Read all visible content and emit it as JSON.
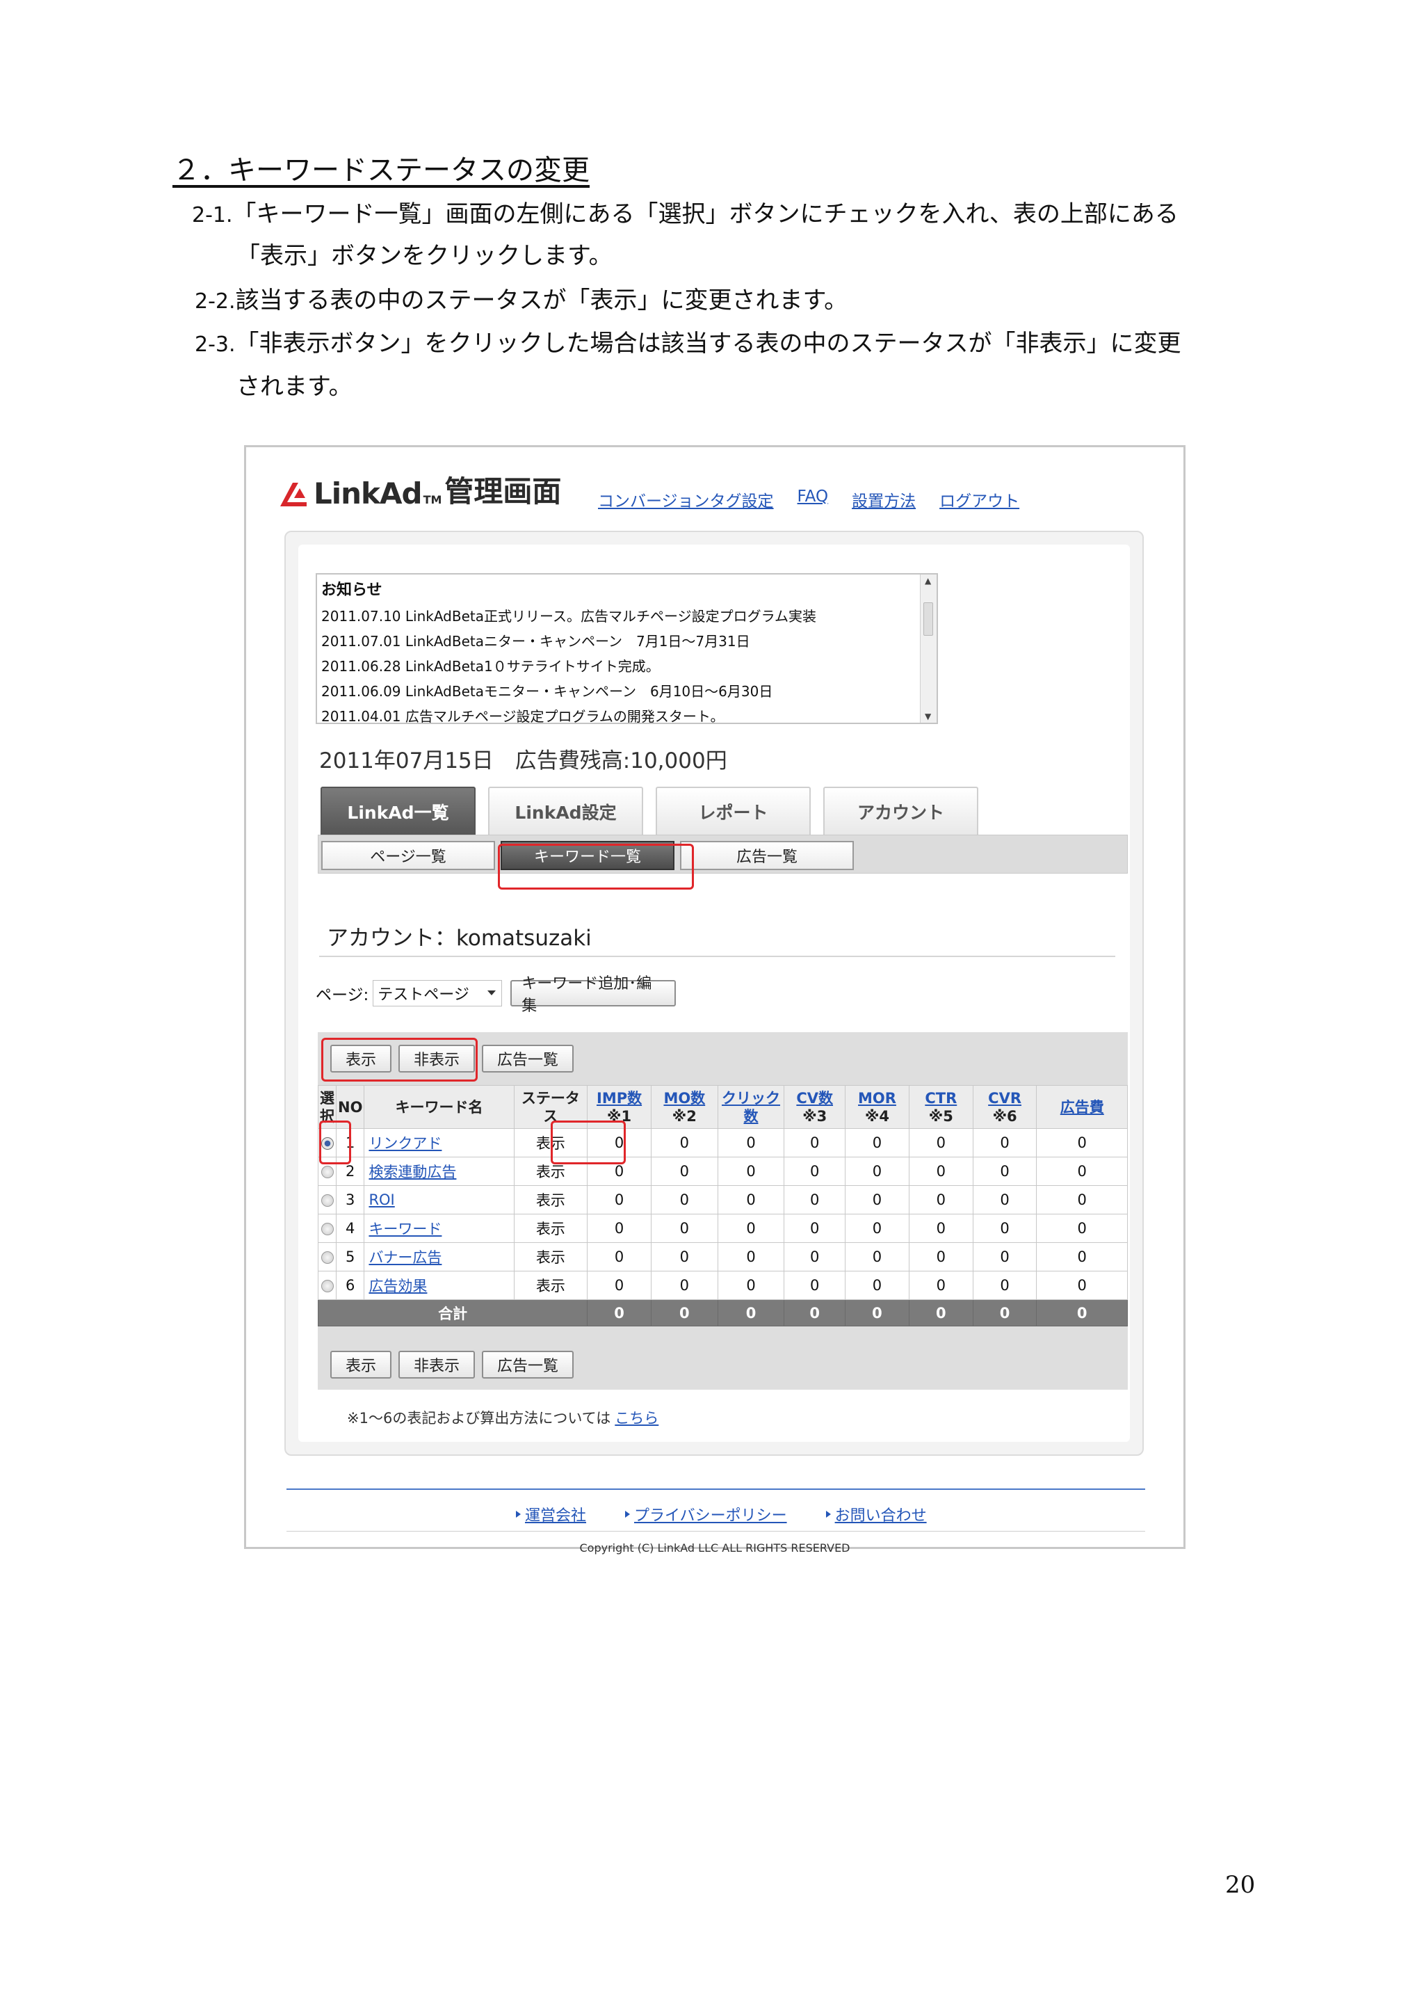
{
  "section_title": "２．キーワードステータスの変更",
  "steps": [
    {
      "num": "2-1.",
      "line1": "「キーワード一覧」画面の左側にある「選択」ボタンにチェックを入れ、表の上部にある",
      "line2": "「表示」ボタンをクリックします。"
    },
    {
      "num": "2-2.",
      "line1": "該当する表の中のステータスが「表示」に変更されます。"
    },
    {
      "num": "2-3.",
      "line1": "「非表示ボタン」をクリックした場合は該当する表の中のステータスが「非表示」に変更",
      "line2": "されます。"
    }
  ],
  "page_number": "20",
  "screenshot": {
    "logo": {
      "text": "LinkAd",
      "tm": "TM",
      "suffix": "管理画面"
    },
    "nav": [
      "コンバージョンタグ設定",
      "FAQ",
      "設置方法",
      "ログアウト"
    ],
    "news": {
      "title": "お知らせ",
      "items": [
        "2011.07.10 LinkAdBeta正式リリース。広告マルチページ設定プログラム実装",
        "2011.07.01 LinkAdBetaニター・キャンペーン　7月1日〜7月31日",
        "2011.06.28 LinkAdBeta1０サテライトサイト完成。",
        "2011.06.09 LinkAdBetaモニター・キャンペーン　6月10日〜6月30日",
        "2011.04.01 広告マルチページ設定プログラムの開発スタート。"
      ]
    },
    "balance": "2011年07月15日　広告費残高:10,000円",
    "tabs": [
      "LinkAd一覧",
      "LinkAd設定",
      "レポート",
      "アカウント"
    ],
    "subtabs": [
      "ページ一覧",
      "キーワード一覧",
      "広告一覧"
    ],
    "account": "アカウント：komatsuzaki",
    "page_label": "ページ:",
    "page_select": "テストページ",
    "edit_button": "キーワード追加･編集",
    "action_buttons": [
      "表示",
      "非表示",
      "広告一覧"
    ],
    "table": {
      "headers": {
        "select": "選択",
        "no": "NO",
        "keyword": "キーワード名",
        "status": "ステータス",
        "imp": "IMP数",
        "imp_note": "※1",
        "mo": "MO数",
        "mo_note": "※2",
        "click": "クリック数",
        "cv": "CV数",
        "cv_note": "※3",
        "mor": "MOR",
        "mor_note": "※4",
        "ctr": "CTR",
        "ctr_note": "※5",
        "cvr": "CVR",
        "cvr_note": "※6",
        "cost": "広告費"
      },
      "rows": [
        {
          "no": "1",
          "keyword": "リンクアド",
          "status": "表示",
          "values": [
            "0",
            "0",
            "0",
            "0",
            "0",
            "0",
            "0",
            "0"
          ]
        },
        {
          "no": "2",
          "keyword": "検索連動広告",
          "status": "表示",
          "values": [
            "0",
            "0",
            "0",
            "0",
            "0",
            "0",
            "0",
            "0"
          ]
        },
        {
          "no": "3",
          "keyword": "ROI",
          "status": "表示",
          "values": [
            "0",
            "0",
            "0",
            "0",
            "0",
            "0",
            "0",
            "0"
          ]
        },
        {
          "no": "4",
          "keyword": "キーワード",
          "status": "表示",
          "values": [
            "0",
            "0",
            "0",
            "0",
            "0",
            "0",
            "0",
            "0"
          ]
        },
        {
          "no": "5",
          "keyword": "バナー広告",
          "status": "表示",
          "values": [
            "0",
            "0",
            "0",
            "0",
            "0",
            "0",
            "0",
            "0"
          ]
        },
        {
          "no": "6",
          "keyword": "広告効果",
          "status": "表示",
          "values": [
            "0",
            "0",
            "0",
            "0",
            "0",
            "0",
            "0",
            "0"
          ]
        }
      ],
      "total_label": "合計",
      "total_values": [
        "0",
        "0",
        "0",
        "0",
        "0",
        "0",
        "0",
        "0"
      ]
    },
    "note": "※1〜6の表記および算出方法については",
    "note_link": "こちら",
    "footer_links": [
      "運営会社",
      "プライバシーポリシー",
      "お問い合わせ"
    ],
    "copyright": "Copyright (C) LinkAd LLC ALL RIGHTS RESERVED"
  },
  "colors": {
    "highlight": "#e0262a",
    "link": "#2456b8",
    "logo_red": "#d8262b"
  }
}
